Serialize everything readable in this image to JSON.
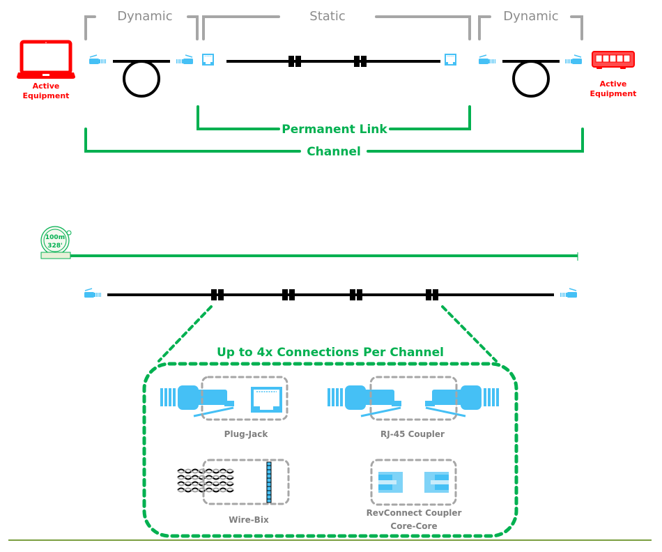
{
  "colors": {
    "green": "#00B050",
    "gray": "#A6A6A6",
    "blue": "#45C0F5",
    "red": "#FF0000",
    "black": "#000000",
    "footer_line": "#4F7F00"
  },
  "top_diagram": {
    "segments": {
      "dynamic_left": "Dynamic",
      "static": "Static",
      "dynamic_right": "Dynamic"
    },
    "left_equipment": {
      "icon": "laptop-icon",
      "label_line1": "Active",
      "label_line2": "Equipment"
    },
    "right_equipment": {
      "icon": "network-switch-icon",
      "label_line1": "Active",
      "label_line2": "Equipment"
    },
    "permanent_link_label": "Permanent Link",
    "channel_label": "Channel",
    "static_connectors": 2
  },
  "length_diagram": {
    "tape_measure": {
      "icon": "tape-measure-icon",
      "metric": "100m",
      "imperial": "328'"
    },
    "connection_points": 4
  },
  "connections_box": {
    "title": "Up to 4x Connections Per Channel",
    "items": [
      {
        "label": "Plug-Jack",
        "icon": "plug-jack-icon"
      },
      {
        "label": "RJ-45 Coupler",
        "icon": "rj45-coupler-icon"
      },
      {
        "label": "Wire-Bix",
        "icon": "wire-bix-icon"
      },
      {
        "label_line1": "RevConnect Coupler",
        "label_line2": "Core-Core",
        "icon": "revconnect-coupler-icon"
      }
    ]
  }
}
